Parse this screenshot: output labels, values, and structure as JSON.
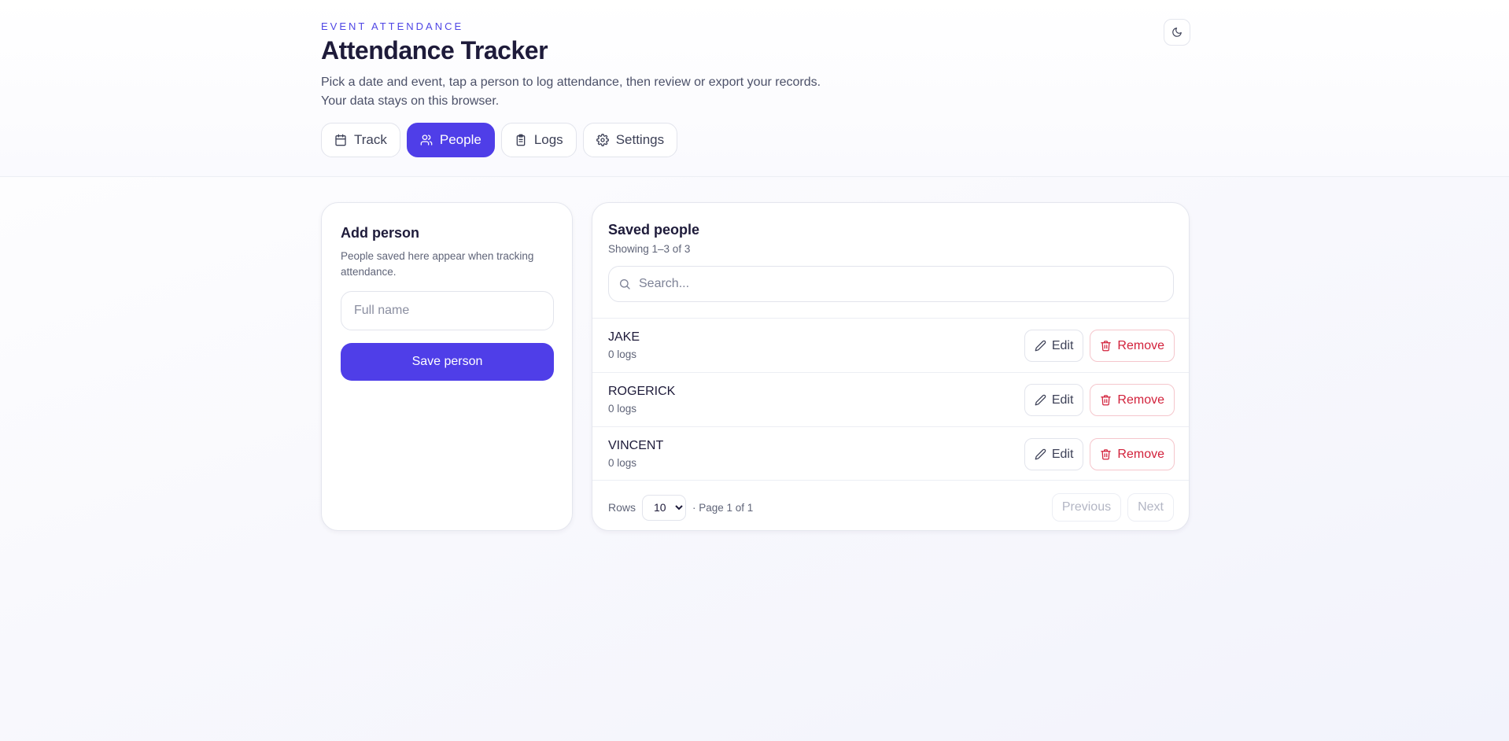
{
  "header": {
    "eyebrow": "EVENT ATTENDANCE",
    "title": "Attendance Tracker",
    "subtitle_line1": "Pick a date and event, tap a person to log attendance, then review or export your records.",
    "subtitle_line2": "Your data stays on this browser.",
    "theme_toggle_icon": "moon-icon"
  },
  "tabs": [
    {
      "label": "Track",
      "icon": "calendar-icon",
      "active": false
    },
    {
      "label": "People",
      "icon": "users-icon",
      "active": true
    },
    {
      "label": "Logs",
      "icon": "clipboard-icon",
      "active": false
    },
    {
      "label": "Settings",
      "icon": "gear-icon",
      "active": false
    }
  ],
  "add_person": {
    "title": "Add person",
    "description": "People saved here appear when tracking attendance.",
    "name_placeholder": "Full name",
    "name_value": "",
    "save_label": "Save person"
  },
  "saved_people": {
    "title": "Saved people",
    "showing": "Showing 1–3 of 3",
    "search_placeholder": "Search...",
    "search_value": "",
    "edit_label": "Edit",
    "remove_label": "Remove",
    "people": [
      {
        "name": "JAKE",
        "logs": "0 logs"
      },
      {
        "name": "ROGERICK",
        "logs": "0 logs"
      },
      {
        "name": "VINCENT",
        "logs": "0 logs"
      }
    ],
    "footer": {
      "rows_label": "Rows",
      "rows_value": "10",
      "rows_options": [
        "10"
      ],
      "page_info": "· Page 1 of 1",
      "previous_label": "Previous",
      "next_label": "Next"
    }
  },
  "colors": {
    "accent": "#4f3ee8",
    "danger": "#d2213b",
    "eyebrow": "#4f46e5"
  }
}
